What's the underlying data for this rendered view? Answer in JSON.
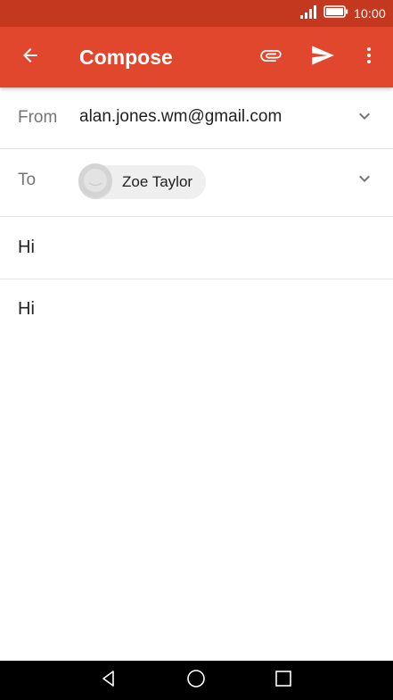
{
  "status_bar": {
    "time": "10:00",
    "icons": [
      "signal-icon",
      "battery-icon"
    ]
  },
  "app_bar": {
    "title": "Compose",
    "icons": {
      "back": "arrow-back-icon",
      "attach": "paperclip-icon",
      "send": "send-icon",
      "more": "more-vert-icon"
    }
  },
  "compose": {
    "from_label": "From",
    "from_value": "alan.jones.wm@gmail.com",
    "to_label": "To",
    "recipient": {
      "name": "Zoe Taylor",
      "avatar_icon": "default-avatar-icon"
    },
    "subject": "Hi",
    "body": "Hi"
  },
  "nav_bar": {
    "icons": [
      "nav-back-icon",
      "nav-home-icon",
      "nav-recents-icon"
    ]
  },
  "colors": {
    "status_bar": "#c4381f",
    "app_bar": "#e0472c",
    "text_primary": "#212121",
    "text_secondary": "#757575",
    "chip_bg": "#efefef",
    "divider": "#e4e4e4",
    "nav_bar": "#000000"
  }
}
